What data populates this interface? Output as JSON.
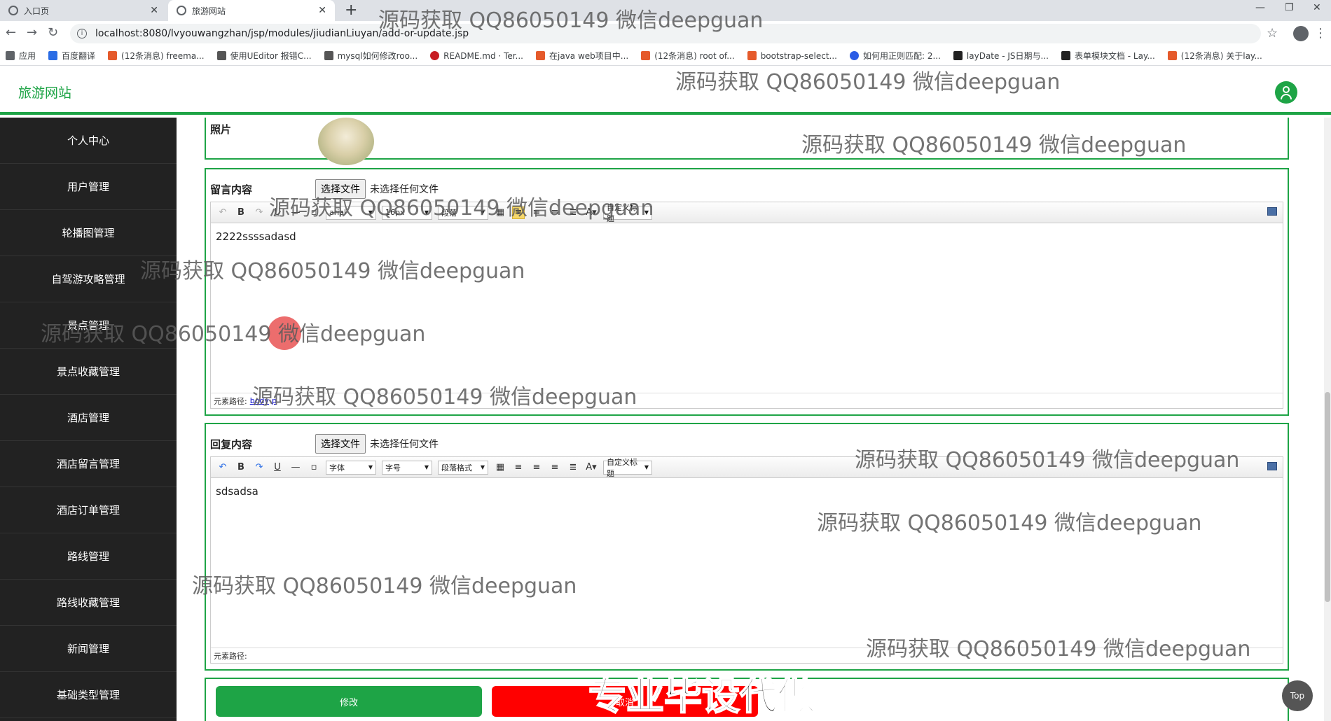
{
  "browser": {
    "tabs": [
      {
        "title": "入口页",
        "active": false
      },
      {
        "title": "旅游网站",
        "active": true
      }
    ],
    "url": "localhost:8080/lvyouwangzhan/jsp/modules/jiudianLiuyan/add-or-update.jsp",
    "bookmarks": [
      {
        "label": "应用",
        "icon": "apps-icon",
        "color": "#5f6368"
      },
      {
        "label": "百度翻译",
        "icon": "baidu-icon",
        "color": "#2b6de5"
      },
      {
        "label": "(12条消息) freema...",
        "icon": "csdn-icon",
        "color": "#e55a2b"
      },
      {
        "label": "使用UEditor 报错C...",
        "icon": "link-icon",
        "color": "#555555"
      },
      {
        "label": "mysql如何修改roo...",
        "icon": "link-icon",
        "color": "#555555"
      },
      {
        "label": "README.md · Ter...",
        "icon": "gitee-icon",
        "color": "#c71d23"
      },
      {
        "label": "在java web项目中...",
        "icon": "csdn-icon",
        "color": "#e55a2b"
      },
      {
        "label": "(12条消息) root of...",
        "icon": "csdn-icon",
        "color": "#e55a2b"
      },
      {
        "label": "bootstrap-select...",
        "icon": "cnblogs-icon",
        "color": "#e55a2b"
      },
      {
        "label": "如何用正则匹配: 2...",
        "icon": "baidu-paw-icon",
        "color": "#2b5ce5"
      },
      {
        "label": "layDate - JS日期与...",
        "icon": "layui-icon",
        "color": "#222222"
      },
      {
        "label": "表单模块文档 - Lay...",
        "icon": "layui-icon",
        "color": "#222222"
      },
      {
        "label": "(12条消息) 关于lay...",
        "icon": "csdn-icon",
        "color": "#e55a2b"
      }
    ]
  },
  "header": {
    "title": "旅游网站"
  },
  "sidebar": {
    "items": [
      "个人中心",
      "用户管理",
      "轮播图管理",
      "自驾游攻略管理",
      "景点管理",
      "景点收藏管理",
      "酒店管理",
      "酒店留言管理",
      "酒店订单管理",
      "路线管理",
      "路线收藏管理",
      "新闻管理",
      "基础类型管理"
    ]
  },
  "form": {
    "photo_label": "照片",
    "message": {
      "label": "留言内容",
      "file_button": "选择文件",
      "file_status": "未选择任何文件",
      "font": "arial",
      "size": "16px",
      "paragraph": "段落",
      "custom_title": "自定义标题",
      "content": "2222ssssadasd",
      "status_label": "元素路径:",
      "status_path_1": "body",
      "status_path_2": "p"
    },
    "reply": {
      "label": "回复内容",
      "file_button": "选择文件",
      "file_status": "未选择任何文件",
      "font": "字体",
      "size": "字号",
      "paragraph": "段落格式",
      "custom_title": "自定义标题",
      "content": "sdsadsa",
      "status_label": "元素路径:"
    },
    "save_button": "修改",
    "cancel_button": "取消"
  },
  "top_button": "Top",
  "overlay": {
    "watermark": "源码获取 QQ86050149 微信deepguan",
    "promo": "专业毕设代做"
  },
  "colors": {
    "accent": "#1ea446",
    "danger": "#ff0000",
    "sidebar": "#222222"
  }
}
